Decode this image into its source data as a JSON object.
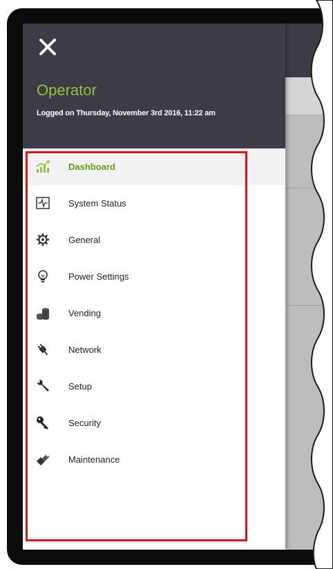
{
  "header": {
    "close_icon": "close-icon",
    "user_name": "Operator",
    "login_info": "Logged on Thursday, November 3rd 2016, 11:22 am"
  },
  "menu": {
    "items": [
      {
        "label": "Dashboard",
        "icon": "dashboard-chart-icon",
        "active": true
      },
      {
        "label": "System Status",
        "icon": "pulse-monitor-icon"
      },
      {
        "label": "General",
        "icon": "gear-icon"
      },
      {
        "label": "Power Settings",
        "icon": "lightbulb-icon"
      },
      {
        "label": "Vending",
        "icon": "coins-icon"
      },
      {
        "label": "Network",
        "icon": "plug-icon"
      },
      {
        "label": "Setup",
        "icon": "wrench-icon"
      },
      {
        "label": "Security",
        "icon": "key-icon"
      },
      {
        "label": "Maintenance",
        "icon": "tools-icon"
      }
    ]
  },
  "colors": {
    "header_bg": "#3e3b47",
    "accent_green": "#8cc63f",
    "active_text": "#5a9e1c",
    "highlight_border": "#e01010"
  }
}
